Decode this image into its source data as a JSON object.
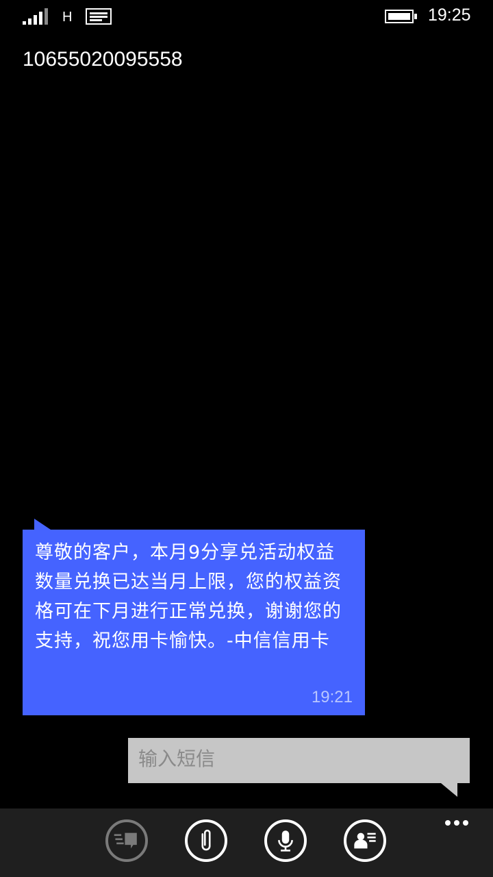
{
  "status_bar": {
    "network_type": "H",
    "time": "19:25",
    "icons": [
      "signal-icon",
      "message-notification-icon",
      "battery-icon"
    ]
  },
  "thread": {
    "contact": "10655020095558"
  },
  "messages": [
    {
      "direction": "incoming",
      "text": "尊敬的客户，本月9分享兑活动权益数量兑换已达当月上限，您的权益资格可在下月进行正常兑换，谢谢您的支持，祝您用卡愉快。-中信信用卡",
      "time": "19:21"
    }
  ],
  "compose": {
    "placeholder": "输入短信",
    "value": ""
  },
  "app_bar": {
    "buttons": [
      "switch-conversation-icon",
      "attach-icon",
      "microphone-icon",
      "contact-card-icon"
    ],
    "more_icon": "more-dots-icon"
  },
  "colors": {
    "background": "#000000",
    "incoming_bubble": "#4563ff",
    "compose_box": "#c6c6c6",
    "app_bar": "#1f1f1f"
  }
}
